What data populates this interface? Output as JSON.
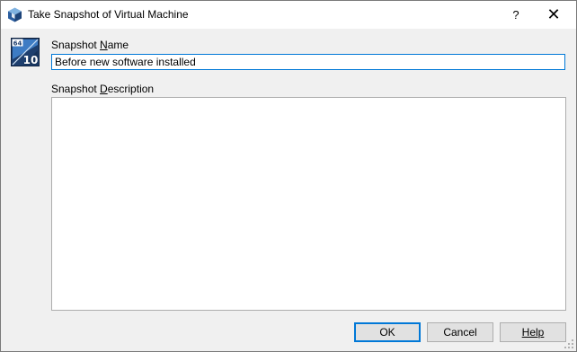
{
  "titlebar": {
    "title": "Take Snapshot of Virtual Machine",
    "help_label": "?",
    "close_label": "✕"
  },
  "vm_badge": {
    "top_text": "64",
    "bottom_text": "10"
  },
  "form": {
    "name_label_pre": "Snapshot ",
    "name_label_accel": "N",
    "name_label_post": "ame",
    "name_value": "Before new software installed",
    "desc_label_pre": "Snapshot ",
    "desc_label_accel": "D",
    "desc_label_post": "escription",
    "desc_value": ""
  },
  "buttons": {
    "ok": "OK",
    "cancel": "Cancel",
    "help": "Help"
  },
  "colors": {
    "accent": "#0078d7",
    "window_bg": "#f0f0f0",
    "titlebar_bg": "#ffffff"
  }
}
